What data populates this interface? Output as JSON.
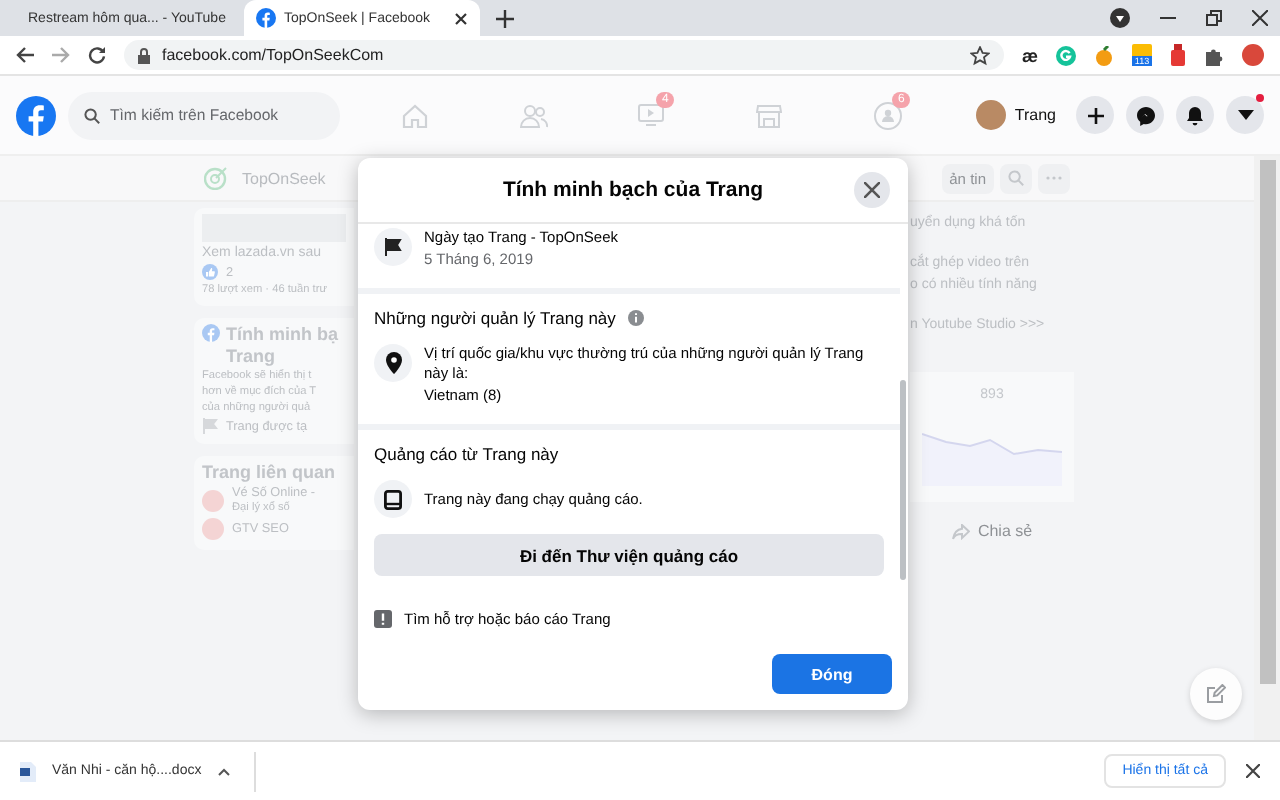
{
  "browser": {
    "tabs": [
      {
        "title": "Restream hôm qua... - YouTube",
        "kind": "youtube",
        "selected": false
      },
      {
        "title": "TopOnSeek | Facebook",
        "kind": "facebook",
        "selected": true
      }
    ],
    "url": "facebook.com/TopOnSeekCom",
    "extension_text": "æ",
    "extension_badge": "113"
  },
  "facebook_header": {
    "search_placeholder": "Tìm kiếm trên Facebook",
    "nav": [
      {
        "kind": "home"
      },
      {
        "kind": "friends"
      },
      {
        "kind": "watch",
        "badge": "4"
      },
      {
        "kind": "marketplace"
      },
      {
        "kind": "groups",
        "badge": "6"
      }
    ],
    "profile_name": "Trang",
    "menu_has_notification": true
  },
  "page_header": {
    "name": "TopOnSeek",
    "button_label": "ản tin"
  },
  "left_column": {
    "post": {
      "title": "Xem lazada.vn sau",
      "likes": "2",
      "meta": "78 lượt xem · 46 tuần trư"
    },
    "transparency_card": {
      "title_line_1": "Tính minh bạ",
      "title_line_2": "Trang",
      "lines": [
        "Facebook sẽ hiển thị t",
        "hơn về mục đích của T",
        "của những người quả"
      ],
      "created": "Trang được tạ"
    },
    "related": {
      "title": "Trang liên quan",
      "pages": [
        {
          "name": "Vé Số Online -",
          "category": "Đại lý xổ số"
        },
        {
          "name": "GTV SEO"
        }
      ]
    }
  },
  "right_column": {
    "lines": [
      "uyển dụng khá tốn",
      "cắt ghép video trên",
      "o có nhiều tính năng",
      "n Youtube Studio >>>"
    ],
    "stat": "893",
    "share": "Chia sẻ"
  },
  "modal": {
    "title": "Tính minh bạch của Trang",
    "created": {
      "label": "Ngày tạo Trang - TopOnSeek",
      "date": "5 Tháng 6, 2019"
    },
    "managers": {
      "heading": "Những người quản lý Trang này",
      "text": "Vị trí quốc gia/khu vực thường trú của những người quản lý Trang này là:",
      "value": "Vietnam (8)"
    },
    "ads": {
      "heading": "Quảng cáo từ Trang này",
      "text": "Trang này đang chạy quảng cáo.",
      "button": "Đi đến Thư viện quảng cáo"
    },
    "report": "Tìm hỗ trợ hoặc báo cáo Trang",
    "close_button": "Đóng"
  },
  "download_bar": {
    "file": "Văn Nhi - căn hộ....docx",
    "show_all": "Hiển thị tất cả"
  }
}
